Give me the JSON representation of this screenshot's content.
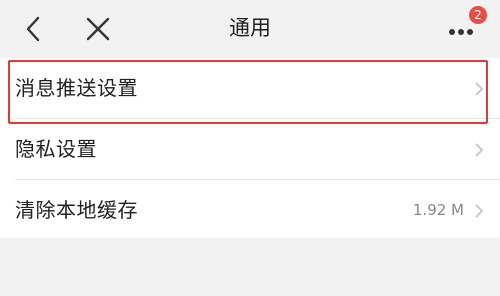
{
  "header": {
    "title": "通用",
    "notification_count": "2"
  },
  "settings": {
    "items": [
      {
        "label": "消息推送设置",
        "value": ""
      },
      {
        "label": "隐私设置",
        "value": ""
      },
      {
        "label": "清除本地缓存",
        "value": "1.92 M"
      }
    ]
  },
  "colors": {
    "background": "#f2f2f2",
    "list_background": "#ffffff",
    "badge": "#e94e46",
    "highlight_border": "#e53935",
    "value_text": "#888888"
  },
  "icons": [
    "back-arrow-icon",
    "close-icon",
    "more-icon",
    "chevron-right-icon"
  ]
}
